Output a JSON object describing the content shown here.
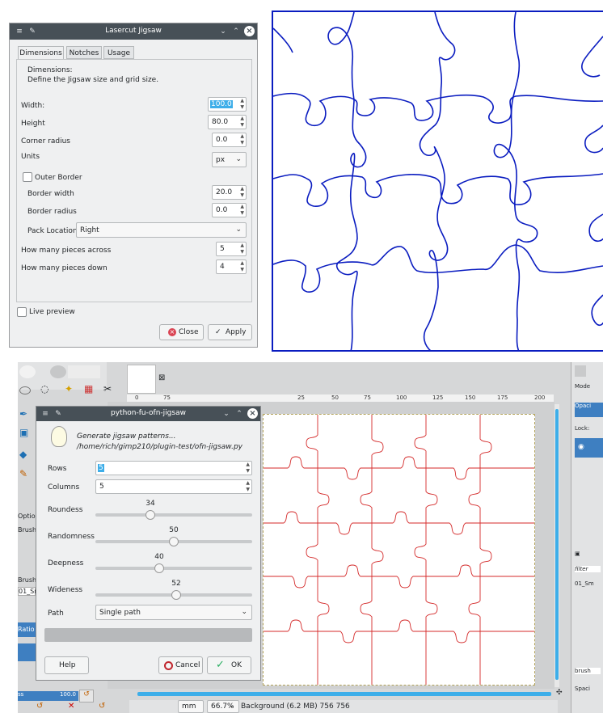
{
  "lasercut": {
    "title": "Lasercut Jigsaw",
    "tabs": [
      "Dimensions",
      "Notches",
      "Usage"
    ],
    "section_title": "Dimensions:",
    "section_desc": "Define the Jigsaw size and grid size.",
    "width_label": "Width:",
    "width_value": "100.0",
    "height_label": "Height",
    "height_value": "80.0",
    "corner_label": "Corner radius",
    "corner_value": "0.0",
    "units_label": "Units",
    "units_value": "px",
    "outer_border_label": "Outer Border",
    "border_width_label": "Border width",
    "border_width_value": "20.0",
    "border_radius_label": "Border radius",
    "border_radius_value": "0.0",
    "pack_label": "Pack Location",
    "pack_value": "Right",
    "across_label": "How many pieces across",
    "across_value": "5",
    "down_label": "How many pieces down",
    "down_value": "4",
    "live_preview_label": "Live preview",
    "close_label": "Close",
    "apply_label": "Apply"
  },
  "python_fu": {
    "title": "python-fu-ofn-jigsaw",
    "desc": "Generate jigsaw patterns...",
    "path_text": "/home/rich/gimp210/plugin-test/ofn-jigsaw.py",
    "rows_label": "Rows",
    "rows_value": "5",
    "columns_label": "Columns",
    "columns_value": "5",
    "roundess_label": "Roundess",
    "roundess_value": 34,
    "randomness_label": "Randomness",
    "randomness_value": 50,
    "deepness_label": "Deepness",
    "deepness_value": 40,
    "wideness_label": "Wideness",
    "wideness_value": 52,
    "path_label": "Path",
    "path_value": "Single path",
    "help_label": "Help",
    "cancel_label": "Cancel",
    "ok_label": "OK"
  },
  "gimp": {
    "ruler_ticks": [
      "0",
      "25",
      "50",
      "75",
      "100",
      "125",
      "150",
      "175",
      "200"
    ],
    "ruler_ticks_left": [
      "0",
      "75"
    ],
    "unit_value": "mm",
    "zoom_value": "66.7%",
    "status_text": "Background (6.2 MB) 756 756",
    "side_labels": [
      "Optio",
      "Brush",
      "Brush",
      "01_Sm",
      "Ratio",
      "ss"
    ],
    "right_labels": [
      "Mode",
      "Opaci",
      "Lock:",
      "filter",
      "01_Sm",
      "brush",
      "Spaci"
    ],
    "right_value": "100.0"
  },
  "colors": {
    "titlebar": "#475057",
    "accent": "#3daee9",
    "blue_puzzle": "#0a1cc0",
    "red_puzzle": "#d42a2a",
    "dialog_bg": "#eff0f1"
  }
}
